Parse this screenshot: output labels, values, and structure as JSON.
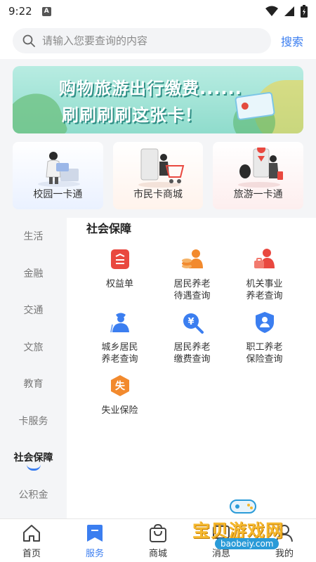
{
  "status_bar": {
    "time": "9:22",
    "notification_glyph": "A",
    "icons": [
      "wifi-icon",
      "signal-icon",
      "battery-icon"
    ]
  },
  "search": {
    "placeholder": "请输入您要查询的内容",
    "button_label": "搜索"
  },
  "banner": {
    "line1": "购物旅游出行缴费......",
    "line2": "刷刷刷刷这张卡！"
  },
  "quick_cards": [
    {
      "label": "校园一卡通",
      "icon": "student-card-illustration"
    },
    {
      "label": "市民卡商城",
      "icon": "shopping-cart-illustration"
    },
    {
      "label": "旅游一卡通",
      "icon": "travel-illustration"
    }
  ],
  "left_nav": {
    "items": [
      {
        "label": "生活"
      },
      {
        "label": "金融"
      },
      {
        "label": "交通"
      },
      {
        "label": "文旅"
      },
      {
        "label": "教育"
      },
      {
        "label": "卡服务"
      },
      {
        "label": "社会保障",
        "active": true
      },
      {
        "label": "公积金"
      }
    ]
  },
  "section": {
    "title": "社会保障",
    "items": [
      {
        "label": "权益单",
        "icon": "document-icon",
        "color": "#e9483f"
      },
      {
        "label": "居民养老\n待遇查询",
        "icon": "elder-coins-icon",
        "color": "#f28a2e"
      },
      {
        "label": "机关事业\n养老查询",
        "icon": "elder-briefcase-icon",
        "color": "#e9483f"
      },
      {
        "label": "城乡居民\n养老查询",
        "icon": "elder-person-icon",
        "color": "#3b7ef0"
      },
      {
        "label": "居民养老\n缴费查询",
        "icon": "yuan-search-icon",
        "color": "#3b7ef0"
      },
      {
        "label": "职工养老\n保险查询",
        "icon": "shield-person-icon",
        "color": "#3b7ef0"
      },
      {
        "label": "失业保险",
        "icon": "unemployment-badge-icon",
        "color": "#f28a2e",
        "glyph": "失"
      }
    ]
  },
  "tabbar": {
    "items": [
      {
        "label": "首页",
        "icon": "home-icon"
      },
      {
        "label": "服务",
        "icon": "service-bookmark-icon",
        "active": true
      },
      {
        "label": "商城",
        "icon": "shopping-bag-icon"
      },
      {
        "label": "消息",
        "icon": "message-icon"
      },
      {
        "label": "我的",
        "icon": "profile-icon"
      }
    ]
  },
  "watermark": {
    "text": "宝贝游戏网",
    "url": "baobeiy.com"
  },
  "colors": {
    "accent": "#3b7ef0",
    "orange": "#f28a2e",
    "red": "#e9483f",
    "nav_bg": "#f4f5f7"
  }
}
